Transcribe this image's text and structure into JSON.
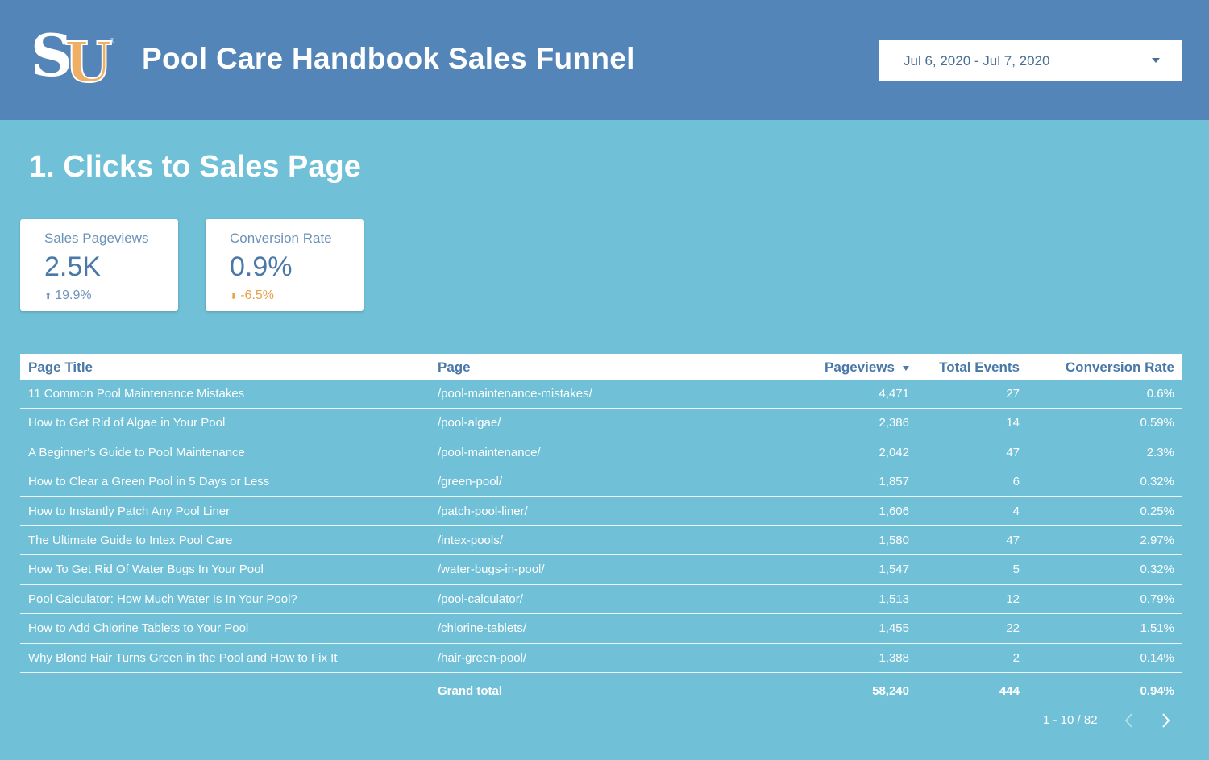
{
  "header": {
    "logo_letters": "SU",
    "title": "Pool Care Handbook Sales Funnel",
    "date_range": "Jul 6, 2020 - Jul 7, 2020"
  },
  "section": {
    "title": "1. Clicks to Sales Page"
  },
  "scorecards": [
    {
      "label": "Sales Pageviews",
      "value": "2.5K",
      "delta": "19.9%",
      "direction": "up"
    },
    {
      "label": "Conversion Rate",
      "value": "0.9%",
      "delta": "-6.5%",
      "direction": "down"
    }
  ],
  "table": {
    "columns": [
      "Page Title",
      "Page",
      "Pageviews",
      "Total Events",
      "Conversion Rate"
    ],
    "sorted_column": "Pageviews",
    "rows": [
      [
        "11 Common Pool Maintenance Mistakes",
        "/pool-maintenance-mistakes/",
        "4,471",
        "27",
        "0.6%"
      ],
      [
        "How to Get Rid of Algae in Your Pool",
        "/pool-algae/",
        "2,386",
        "14",
        "0.59%"
      ],
      [
        "A Beginner's Guide to Pool Maintenance",
        "/pool-maintenance/",
        "2,042",
        "47",
        "2.3%"
      ],
      [
        "How to Clear a Green Pool in 5 Days or Less",
        "/green-pool/",
        "1,857",
        "6",
        "0.32%"
      ],
      [
        "How to Instantly Patch Any Pool Liner",
        "/patch-pool-liner/",
        "1,606",
        "4",
        "0.25%"
      ],
      [
        "The Ultimate Guide to Intex Pool Care",
        "/intex-pools/",
        "1,580",
        "47",
        "2.97%"
      ],
      [
        "How To Get Rid Of Water Bugs In Your Pool",
        "/water-bugs-in-pool/",
        "1,547",
        "5",
        "0.32%"
      ],
      [
        "Pool Calculator: How Much Water Is In Your Pool?",
        "/pool-calculator/",
        "1,513",
        "12",
        "0.79%"
      ],
      [
        "How to Add Chlorine Tablets to Your Pool",
        "/chlorine-tablets/",
        "1,455",
        "22",
        "1.51%"
      ],
      [
        "Why Blond Hair Turns Green in the Pool and How to Fix It",
        "/hair-green-pool/",
        "1,388",
        "2",
        "0.14%"
      ]
    ],
    "grand_total": {
      "label": "Grand total",
      "pageviews": "58,240",
      "events": "444",
      "conversion": "0.94%"
    },
    "pagination": "1 - 10 / 82"
  },
  "colors": {
    "header_bg": "#5385b8",
    "page_bg": "#70c1d8",
    "accent_text": "#4a78a8",
    "negative": "#e8a04c",
    "logo_u": "#efb066"
  },
  "icons": {
    "date_dropdown": "caret-down-icon",
    "sort": "sort-desc-icon",
    "delta_up": "arrow-up-icon",
    "delta_down": "arrow-down-icon",
    "prev": "chevron-left-icon",
    "next": "chevron-right-icon"
  }
}
